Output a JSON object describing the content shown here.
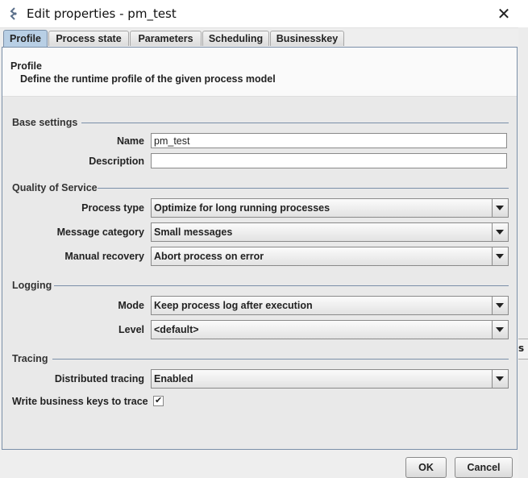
{
  "window": {
    "title": "Edit properties - pm_test",
    "icon": "app-icon",
    "close_glyph": "✕"
  },
  "tabs": [
    {
      "label": "Profile",
      "active": true
    },
    {
      "label": "Process state",
      "active": false
    },
    {
      "label": "Parameters",
      "active": false
    },
    {
      "label": "Scheduling",
      "active": false
    },
    {
      "label": "Businesskey",
      "active": false
    }
  ],
  "header": {
    "title": "Profile",
    "subtitle": "Define the runtime profile of the given process model"
  },
  "base_settings": {
    "section": "Base settings",
    "name_label": "Name",
    "name_value": "pm_test",
    "description_label": "Description",
    "description_value": ""
  },
  "qos": {
    "section": "Quality of Service",
    "process_type_label": "Process type",
    "process_type_value": "Optimize for long running processes",
    "message_category_label": "Message category",
    "message_category_value": "Small messages",
    "manual_recovery_label": "Manual recovery",
    "manual_recovery_value": "Abort process on error"
  },
  "logging": {
    "section": "Logging",
    "mode_label": "Mode",
    "mode_value": "Keep process log after execution",
    "level_label": "Level",
    "level_value": "<default>"
  },
  "tracing": {
    "section": "Tracing",
    "distributed_label": "Distributed tracing",
    "distributed_value": "Enabled",
    "write_keys_label": "Write business keys to trace",
    "write_keys_checked": true,
    "check_glyph": "✔"
  },
  "buttons": {
    "ok": "OK",
    "cancel": "Cancel"
  },
  "background_fragment": "s",
  "colors": {
    "active_tab": "#b8cfe5",
    "section_line": "#7a8fa8",
    "content_bg": "#e9e9e9"
  }
}
